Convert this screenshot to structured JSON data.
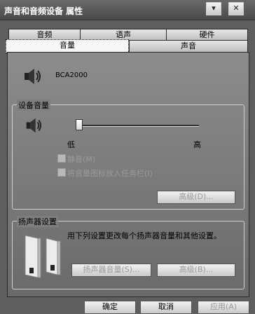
{
  "window": {
    "title": "声音和音频设备 属性",
    "btn_min": "▾",
    "btn_close": "✕"
  },
  "tabs_row1": [
    "音频",
    "语声",
    "硬件"
  ],
  "tabs_row2": [
    "音量",
    "声音"
  ],
  "device": {
    "name": "BCA2000"
  },
  "device_volume": {
    "label": "设备音量",
    "low": "低",
    "high": "高",
    "level_percent": 0,
    "mute": "静音(M)",
    "tray": "将音量图标放入任务栏(I)",
    "advanced": "高级(D)..."
  },
  "speaker_settings": {
    "label": "扬声器设置",
    "description": "用下列设置更改每个扬声器音量和其他设置。",
    "volume_button": "扬声器音量(S)...",
    "advanced_button": "高级(B)..."
  },
  "footer": {
    "ok": "确定",
    "cancel": "取消",
    "apply": "应用(A)"
  },
  "colors": {
    "panel": "#7f7f7f",
    "titlebar": "#555555"
  }
}
